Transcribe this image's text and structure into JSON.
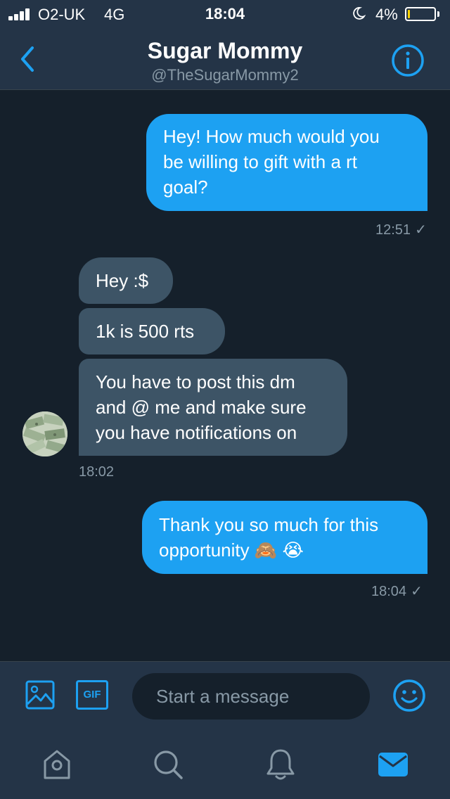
{
  "status_bar": {
    "carrier": "O2-UK",
    "network": "4G",
    "time": "18:04",
    "battery_percent": "4%",
    "battery_level": 0.04,
    "signal_bars": 4
  },
  "header": {
    "title": "Sugar Mommy",
    "handle": "@TheSugarMommy2",
    "back_icon": "chevron-left-icon",
    "info_icon": "info-icon"
  },
  "messages": [
    {
      "direction": "out",
      "lines": [
        "Hey! How much would you",
        "be willing to gift with a rt",
        "goal?"
      ]
    },
    {
      "direction": "in",
      "lines": [
        "Hey :$"
      ]
    },
    {
      "direction": "in",
      "lines": [
        "1k is 500 rts"
      ]
    },
    {
      "direction": "in",
      "lines": [
        "You have to post this dm",
        "and @ me and make sure",
        "you have notifications on"
      ]
    },
    {
      "direction": "out",
      "lines": [
        "Thank you so much for this",
        "opportunity 🙈 😭"
      ]
    }
  ],
  "timestamps": {
    "t1": "12:51",
    "t2": "18:02",
    "t3": "18:04",
    "check": "✓"
  },
  "composer": {
    "placeholder": "Start a message",
    "gif_label": "GIF",
    "image_icon": "image-icon",
    "emoji_icon": "smiley-icon"
  },
  "tabbar": {
    "items": [
      "home-icon",
      "search-icon",
      "notifications-icon",
      "messages-icon"
    ],
    "active": "messages-icon"
  },
  "colors": {
    "accent": "#1da1f2",
    "background": "#15202b",
    "bar": "#243447",
    "incoming_bubble": "#3d5466",
    "secondary_text": "#8899a6"
  }
}
